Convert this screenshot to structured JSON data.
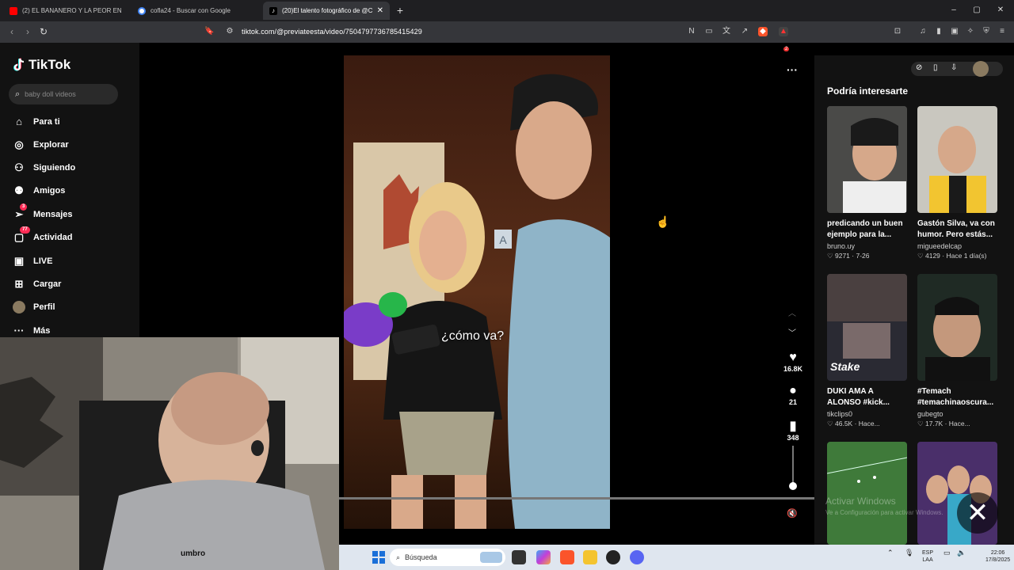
{
  "browser": {
    "tabs": [
      {
        "label": "(2) EL BANANERO Y LA PEOR EN",
        "favicon_color": "#ff0000"
      },
      {
        "label": "cofla24 - Buscar con Google",
        "favicon_color": "#4285f4"
      },
      {
        "label": "(20)El talento fotográfico de @C",
        "favicon_color": "#000000"
      }
    ],
    "url": "tiktok.com/@previateesta/video/7504797736785415429",
    "shield_badge": "2"
  },
  "tiktok": {
    "logo": "TikTok",
    "search_placeholder": "baby doll videos",
    "nav": [
      {
        "label": "Para ti",
        "icon": "home-icon"
      },
      {
        "label": "Explorar",
        "icon": "compass-icon"
      },
      {
        "label": "Siguiendo",
        "icon": "following-icon"
      },
      {
        "label": "Amigos",
        "icon": "friends-icon"
      },
      {
        "label": "Mensajes",
        "icon": "send-icon",
        "badge": "3"
      },
      {
        "label": "Actividad",
        "icon": "activity-icon",
        "badge": "77"
      },
      {
        "label": "LIVE",
        "icon": "live-icon"
      },
      {
        "label": "Cargar",
        "icon": "upload-icon"
      },
      {
        "label": "Perfil",
        "icon": "avatar-icon"
      },
      {
        "label": "Más",
        "icon": "more-icon"
      }
    ],
    "video": {
      "caption": "¿cómo va?",
      "likes": "16.8K",
      "comments": "21",
      "saves": "348"
    },
    "rail": {
      "title": "Podría interesarte",
      "cards": [
        {
          "title": "predicando un buen ejemplo para la...",
          "user": "bruno.uy",
          "likes": "9271",
          "date": "7-26",
          "color": "#3a3a3a"
        },
        {
          "title": "Gastón Silva, va con humor. Pero estás...",
          "user": "migueedelcap",
          "likes": "4129",
          "date": "Hace 1 día(s)",
          "color": "#c9b27a"
        },
        {
          "title": "DUKI AMA A ALONSO #kick...",
          "user": "tikclips0",
          "likes": "46.5K",
          "date": "Hace...",
          "color": "#2a2a33"
        },
        {
          "title": "#Temach #temachinaoscura...",
          "user": "gubegto",
          "likes": "17.7K",
          "date": "Hace...",
          "color": "#1d2a22"
        },
        {
          "title": "",
          "user": "",
          "likes": "",
          "date": "",
          "color": "#2f6a3a"
        },
        {
          "title": "",
          "user": "",
          "likes": "",
          "date": "",
          "color": "#4a2f6a"
        }
      ]
    }
  },
  "windows": {
    "search_placeholder": "Búsqueda",
    "lang": "ESP",
    "lang2": "LAA",
    "time": "22:06",
    "date": "17/8/2025",
    "activate_line1": "Activar Windows",
    "activate_line2": "Ve a Configuración para activar Windows."
  }
}
